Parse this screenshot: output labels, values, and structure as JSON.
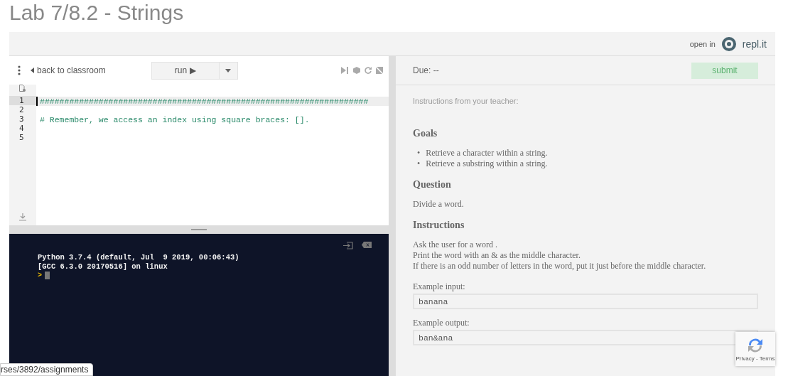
{
  "page_title": "Lab 7/8.2 - Strings",
  "header": {
    "open_in": "open in",
    "brand": "repl.it"
  },
  "toolbar": {
    "back": "back to classroom",
    "run": "run ▶"
  },
  "editor": {
    "lines": [
      {
        "number": "1",
        "text": "###################################################################",
        "current": true
      },
      {
        "number": "2",
        "current": false
      },
      {
        "number": "3",
        "text": "# Remember, we access an index using square braces: [].",
        "current": false
      },
      {
        "number": "4",
        "current": false
      },
      {
        "number": "5",
        "current": false
      }
    ]
  },
  "console": {
    "lines": [
      "Python 3.7.4 (default, Jul  9 2019, 00:06:43)",
      "[GCC 6.3.0 20170516] on linux"
    ],
    "prompt": ">"
  },
  "assignment": {
    "due": "Due: --",
    "submit": "submit",
    "from_teacher": "Instructions from your teacher:",
    "sections": [
      {
        "kind": "heading",
        "text": "Goals"
      },
      {
        "kind": "bullets",
        "marker": "•",
        "items": [
          "Retrieve a character within a string.",
          "Retrieve a substring within a string."
        ]
      },
      {
        "kind": "heading",
        "text": "Question"
      },
      {
        "kind": "para",
        "lines": [
          "Divide a word."
        ]
      },
      {
        "kind": "heading",
        "text": "Instructions"
      },
      {
        "kind": "para",
        "lines": [
          "Ask the user for a word .",
          "Print the word with an & as the middle character.",
          "If there is an odd number of letters in the word, put it just before the middle character."
        ]
      },
      {
        "kind": "example",
        "label": "Example input:",
        "value": "banana"
      },
      {
        "kind": "example",
        "label": "Example output:",
        "value": "ban&ana"
      }
    ]
  },
  "recaptcha": {
    "text": "Privacy - Terms"
  },
  "status_url": "rses/3892/assignments"
}
